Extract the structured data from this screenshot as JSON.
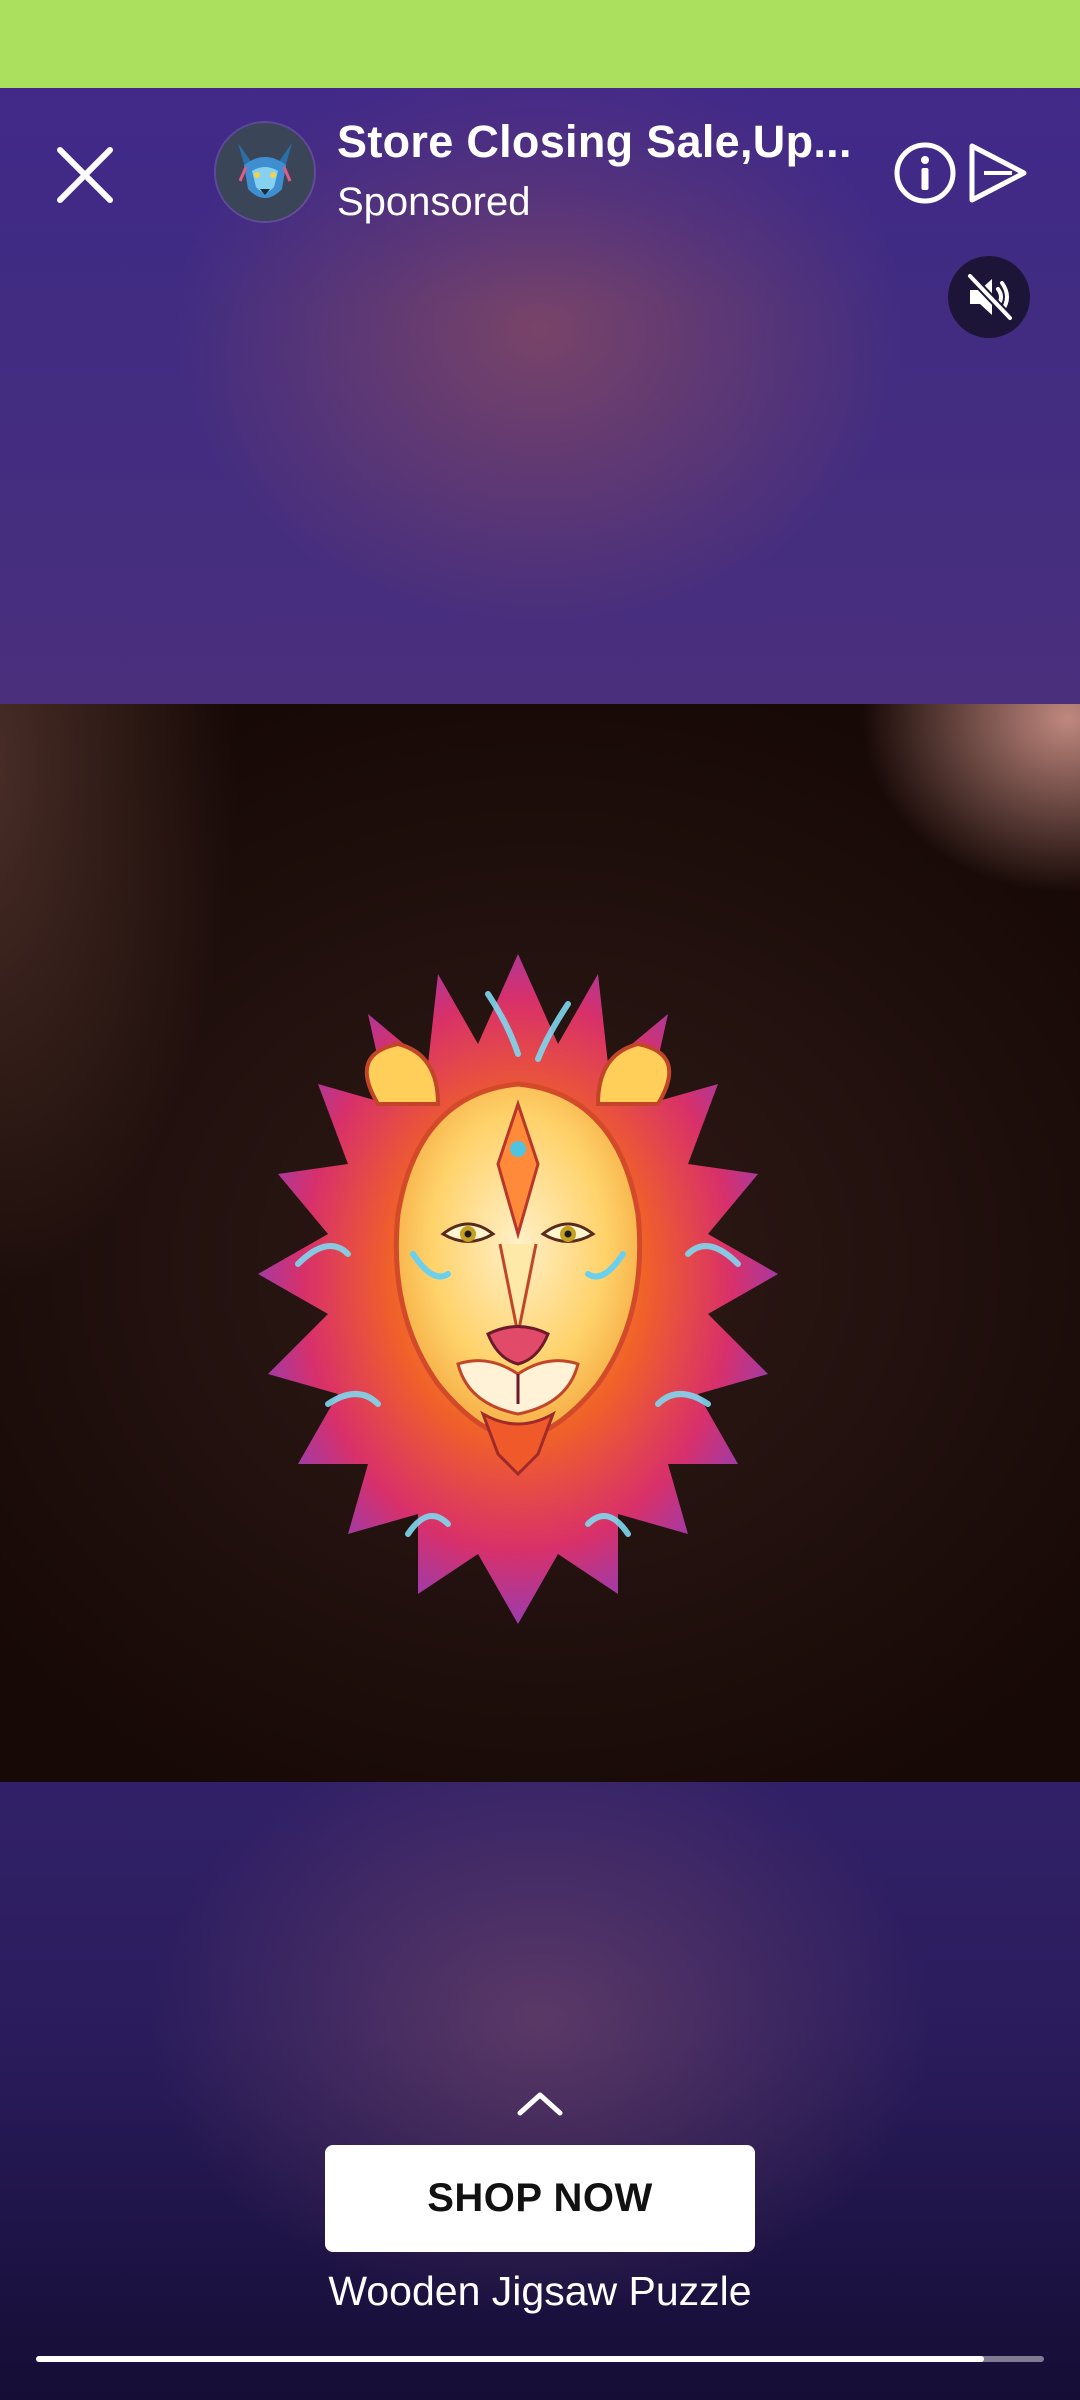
{
  "header": {
    "title": "Store Closing Sale,Up...",
    "subtitle": "Sponsored",
    "close_icon": "close-icon",
    "info_icon": "info-icon",
    "share_icon": "share-icon",
    "mute_icon": "speaker-muted-icon",
    "avatar": "wolf-avatar"
  },
  "media": {
    "content": "lion-jigsaw-puzzle-image"
  },
  "cta": {
    "swipe_icon": "chevron-up-icon",
    "button_label": "SHOP NOW",
    "caption": "Wooden Jigsaw Puzzle"
  },
  "progress": {
    "fraction": 0.94
  },
  "colors": {
    "status_bar": "#abe05e",
    "background": "#3a2a86",
    "button": "#ffffff"
  }
}
